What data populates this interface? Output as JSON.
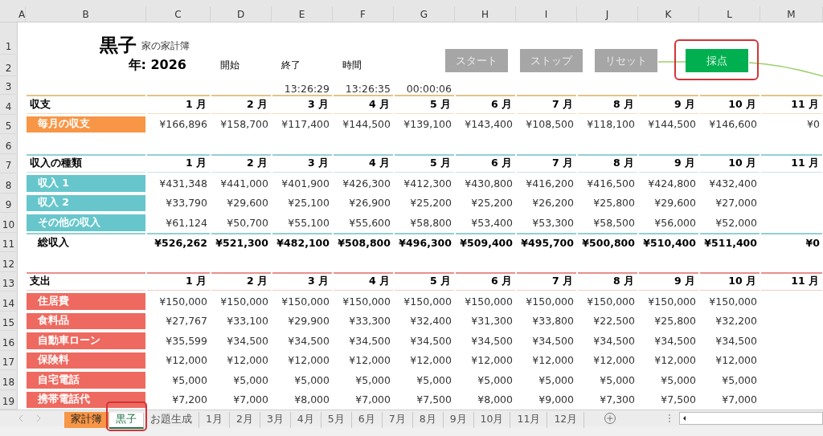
{
  "column_headers": [
    "A",
    "B",
    "C",
    "D",
    "E",
    "F",
    "G",
    "H",
    "I",
    "J",
    "K",
    "L",
    "M"
  ],
  "row_numbers": [
    "1",
    "2",
    "3",
    "4",
    "5",
    "6",
    "7",
    "8",
    "9",
    "10",
    "11",
    "12",
    "13",
    "14",
    "15",
    "16",
    "17",
    "18",
    "19"
  ],
  "title": {
    "name": "黒子",
    "subtitle": "家の家計簿"
  },
  "year": "年: 2026",
  "timer": {
    "labels": [
      "開始",
      "終了",
      "時間"
    ],
    "values": [
      "13:26:29",
      "13:26:35",
      "00:00:06"
    ]
  },
  "buttons": [
    {
      "label": "スタート",
      "kind": "gray",
      "highlighted": false
    },
    {
      "label": "ストップ",
      "kind": "gray",
      "highlighted": false
    },
    {
      "label": "リセット",
      "kind": "gray",
      "highlighted": false
    },
    {
      "label": "採点",
      "kind": "green",
      "highlighted": true
    }
  ],
  "sections": [
    {
      "kind": "balance",
      "title": "収支",
      "months": [
        "1 月",
        "2 月",
        "3 月",
        "4 月",
        "5 月",
        "6 月",
        "7 月",
        "8 月",
        "9 月",
        "10 月",
        "11 月"
      ],
      "rows": [
        {
          "label": "毎月の収支",
          "values": [
            "¥166,896",
            "¥158,700",
            "¥117,400",
            "¥144,500",
            "¥139,100",
            "¥143,400",
            "¥108,500",
            "¥118,100",
            "¥144,500",
            "¥146,600",
            "¥0"
          ]
        }
      ]
    },
    {
      "kind": "income",
      "title": "収入の種類",
      "months": [
        "1 月",
        "2 月",
        "3 月",
        "4 月",
        "5 月",
        "6 月",
        "7 月",
        "8 月",
        "9 月",
        "10 月",
        "11 月"
      ],
      "rows": [
        {
          "label": "収入 1",
          "values": [
            "¥431,348",
            "¥441,000",
            "¥401,900",
            "¥426,300",
            "¥412,300",
            "¥430,800",
            "¥416,200",
            "¥416,500",
            "¥424,800",
            "¥432,400"
          ]
        },
        {
          "label": "収入 2",
          "values": [
            "¥33,790",
            "¥29,600",
            "¥25,100",
            "¥26,900",
            "¥25,200",
            "¥25,200",
            "¥26,200",
            "¥25,800",
            "¥29,600",
            "¥27,000"
          ]
        },
        {
          "label": "その他の収入",
          "values": [
            "¥61,124",
            "¥50,700",
            "¥55,100",
            "¥55,600",
            "¥58,800",
            "¥53,400",
            "¥53,300",
            "¥58,500",
            "¥56,000",
            "¥52,000"
          ]
        }
      ],
      "total": {
        "label": "総収入",
        "values": [
          "¥526,262",
          "¥521,300",
          "¥482,100",
          "¥508,800",
          "¥496,300",
          "¥509,400",
          "¥495,700",
          "¥500,800",
          "¥510,400",
          "¥511,400",
          "¥0"
        ]
      }
    },
    {
      "kind": "expense",
      "title": "支出",
      "months": [
        "1 月",
        "2 月",
        "3 月",
        "4 月",
        "5 月",
        "6 月",
        "7 月",
        "8 月",
        "9 月",
        "10 月",
        "11 月"
      ],
      "rows": [
        {
          "label": "住居費",
          "values": [
            "¥150,000",
            "¥150,000",
            "¥150,000",
            "¥150,000",
            "¥150,000",
            "¥150,000",
            "¥150,000",
            "¥150,000",
            "¥150,000",
            "¥150,000"
          ]
        },
        {
          "label": "食料品",
          "values": [
            "¥27,767",
            "¥33,100",
            "¥29,900",
            "¥33,300",
            "¥32,400",
            "¥31,300",
            "¥33,800",
            "¥22,500",
            "¥25,800",
            "¥32,200"
          ]
        },
        {
          "label": "自動車ローン",
          "values": [
            "¥35,599",
            "¥34,500",
            "¥34,500",
            "¥34,500",
            "¥34,500",
            "¥34,500",
            "¥34,500",
            "¥34,500",
            "¥34,500",
            "¥34,500"
          ]
        },
        {
          "label": "保険料",
          "values": [
            "¥12,000",
            "¥12,000",
            "¥12,000",
            "¥12,000",
            "¥12,000",
            "¥12,000",
            "¥12,000",
            "¥12,000",
            "¥12,000",
            "¥12,000"
          ]
        },
        {
          "label": "自宅電話",
          "values": [
            "¥5,000",
            "¥5,000",
            "¥5,000",
            "¥5,000",
            "¥5,000",
            "¥5,000",
            "¥5,000",
            "¥5,000",
            "¥5,000",
            "¥5,000"
          ]
        },
        {
          "label": "携帯電話代",
          "values": [
            "¥7,200",
            "¥7,000",
            "¥8,000",
            "¥7,000",
            "¥7,500",
            "¥8,000",
            "¥9,000",
            "¥7,300",
            "¥7,500",
            "¥7,000"
          ]
        }
      ]
    }
  ],
  "sheet_tabs": [
    {
      "label": "家計簿",
      "selected": false,
      "highlighted": false,
      "color": "#f79646"
    },
    {
      "label": "黒子",
      "selected": true,
      "highlighted": true
    },
    {
      "label": "お題生成",
      "selected": false,
      "highlighted": false
    },
    {
      "label": "1月",
      "selected": false,
      "highlighted": false
    },
    {
      "label": "2月",
      "selected": false,
      "highlighted": false
    },
    {
      "label": "3月",
      "selected": false,
      "highlighted": false
    },
    {
      "label": "4月",
      "selected": false,
      "highlighted": false
    },
    {
      "label": "5月",
      "selected": false,
      "highlighted": false
    },
    {
      "label": "6月",
      "selected": false,
      "highlighted": false
    },
    {
      "label": "7月",
      "selected": false,
      "highlighted": false
    },
    {
      "label": "8月",
      "selected": false,
      "highlighted": false
    },
    {
      "label": "9月",
      "selected": false,
      "highlighted": false
    },
    {
      "label": "10月",
      "selected": false,
      "highlighted": false
    },
    {
      "label": "11月",
      "selected": false,
      "highlighted": false
    },
    {
      "label": "12月",
      "selected": false,
      "highlighted": false
    }
  ]
}
